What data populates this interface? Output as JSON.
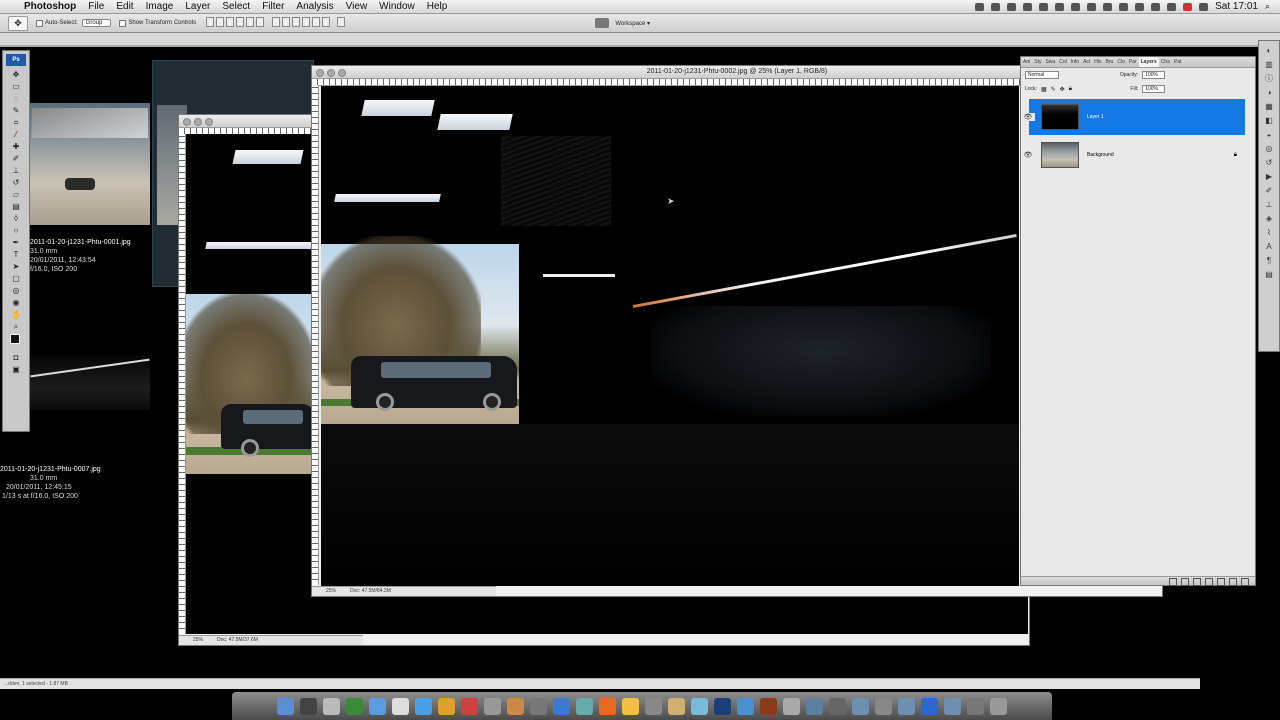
{
  "menubar": {
    "apple": "",
    "app": "Photoshop",
    "items": [
      "File",
      "Edit",
      "Image",
      "Layer",
      "Select",
      "Filter",
      "Analysis",
      "View",
      "Window",
      "Help"
    ],
    "clock": "Sat 17:01"
  },
  "options_bar": {
    "auto_select_label": "Auto-Select:",
    "auto_select_value": "Group",
    "show_transform_label": "Show Transform Controls",
    "workspace_label": "Workspace ▾"
  },
  "bridge": {
    "items": [
      {
        "filename": "2011-01-20-j1231-Phtu-0001.jpg",
        "focal": "31.0 mm",
        "datetime": "20/01/2011, 12:43:54",
        "exposure": "f/16.0, ISO 200"
      },
      {
        "filename": "2011-01-20-j1231-Phtu-0007.jpg",
        "focal": "31.0 mm",
        "datetime": "20/01/2011, 12:45:15",
        "exposure": "1/13 s at f/16.0, ISO 200"
      }
    ]
  },
  "doc_back": {
    "zoom": "25%",
    "doc_size": "Doc: 47.5M/37.6M"
  },
  "doc_front": {
    "title": "2011-01-20-j1231-Phtu-0002.jpg @ 25% (Layer 1, RGB/8)",
    "zoom": "25%",
    "doc_size": "Doc: 47.5M/84.3M"
  },
  "layers_panel": {
    "tabs": [
      "Ani",
      "Sty",
      "Swa",
      "Col",
      "Info",
      "Act",
      "His",
      "Bru",
      "Clo",
      "Par",
      "Layers",
      "Cha",
      "Pat"
    ],
    "blend_mode": "Normal",
    "opacity_label": "Opacity:",
    "opacity_value": "100%",
    "lock_label": "Lock:",
    "fill_label": "Fill:",
    "fill_value": "100%",
    "layers": [
      {
        "name": "Layer 1",
        "selected": true
      },
      {
        "name": "Background",
        "selected": false
      }
    ]
  },
  "bottom_status": "...dden, 1 selected - 1.87 MB",
  "colors": {
    "selection_blue": "#1479e4",
    "ps_blue": "#1e5aa8"
  }
}
